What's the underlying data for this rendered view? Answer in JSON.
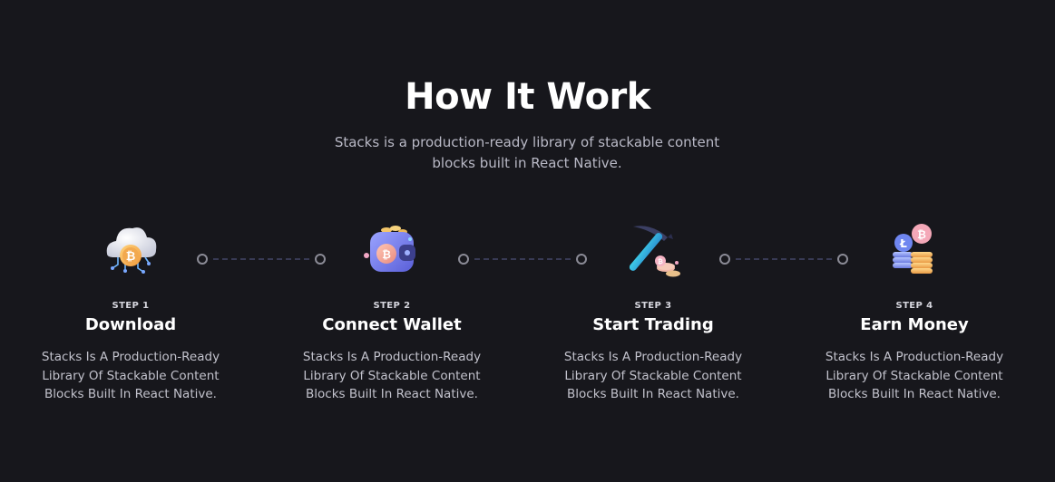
{
  "section": {
    "title": "How It Work",
    "subtitle": "Stacks is a production-ready library of stackable content blocks built in React Native."
  },
  "steps": [
    {
      "label": "STEP 1",
      "name": "Download",
      "description": "Stacks Is A Production-Ready Library Of Stackable Content Blocks Built In React Native.",
      "icon": "cloud-bitcoin-icon"
    },
    {
      "label": "STEP 2",
      "name": "Connect Wallet",
      "description": "Stacks Is A Production-Ready Library Of Stackable Content Blocks Built In React Native.",
      "icon": "wallet-icon"
    },
    {
      "label": "STEP 3",
      "name": "Start Trading",
      "description": "Stacks Is A Production-Ready Library Of Stackable Content Blocks Built In React Native.",
      "icon": "pickaxe-icon"
    },
    {
      "label": "STEP 4",
      "name": "Earn Money",
      "description": "Stacks Is A Production-Ready Library Of Stackable Content Blocks Built In React Native.",
      "icon": "coin-stack-icon"
    }
  ],
  "colors": {
    "background": "#17171c",
    "heading": "#ffffff",
    "body_text": "#c2c2cc",
    "connector": "#383a55"
  }
}
